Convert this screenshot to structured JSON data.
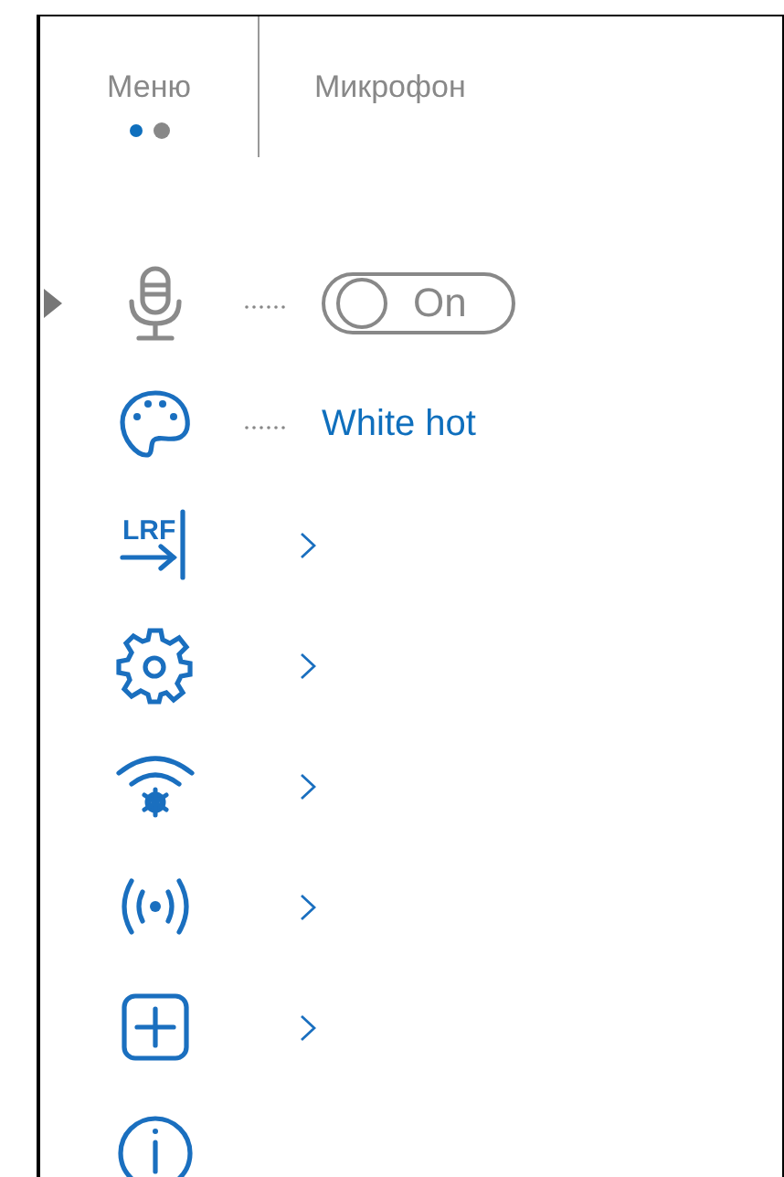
{
  "tabs": [
    {
      "label": "Меню",
      "pages": [
        {
          "selected": true
        },
        {
          "selected": false
        }
      ]
    },
    {
      "label": "Микрофон"
    }
  ],
  "menu": [
    {
      "kind": "toggle",
      "selected": true,
      "value": "On",
      "on": true
    },
    {
      "kind": "value",
      "selected": false,
      "value": "White hot"
    },
    {
      "kind": "submenu",
      "selected": false,
      "icon_text": "LRF"
    },
    {
      "kind": "submenu",
      "selected": false
    },
    {
      "kind": "submenu",
      "selected": false
    },
    {
      "kind": "submenu",
      "selected": false
    },
    {
      "kind": "submenu",
      "selected": false
    },
    {
      "kind": "plain",
      "selected": false
    }
  ]
}
